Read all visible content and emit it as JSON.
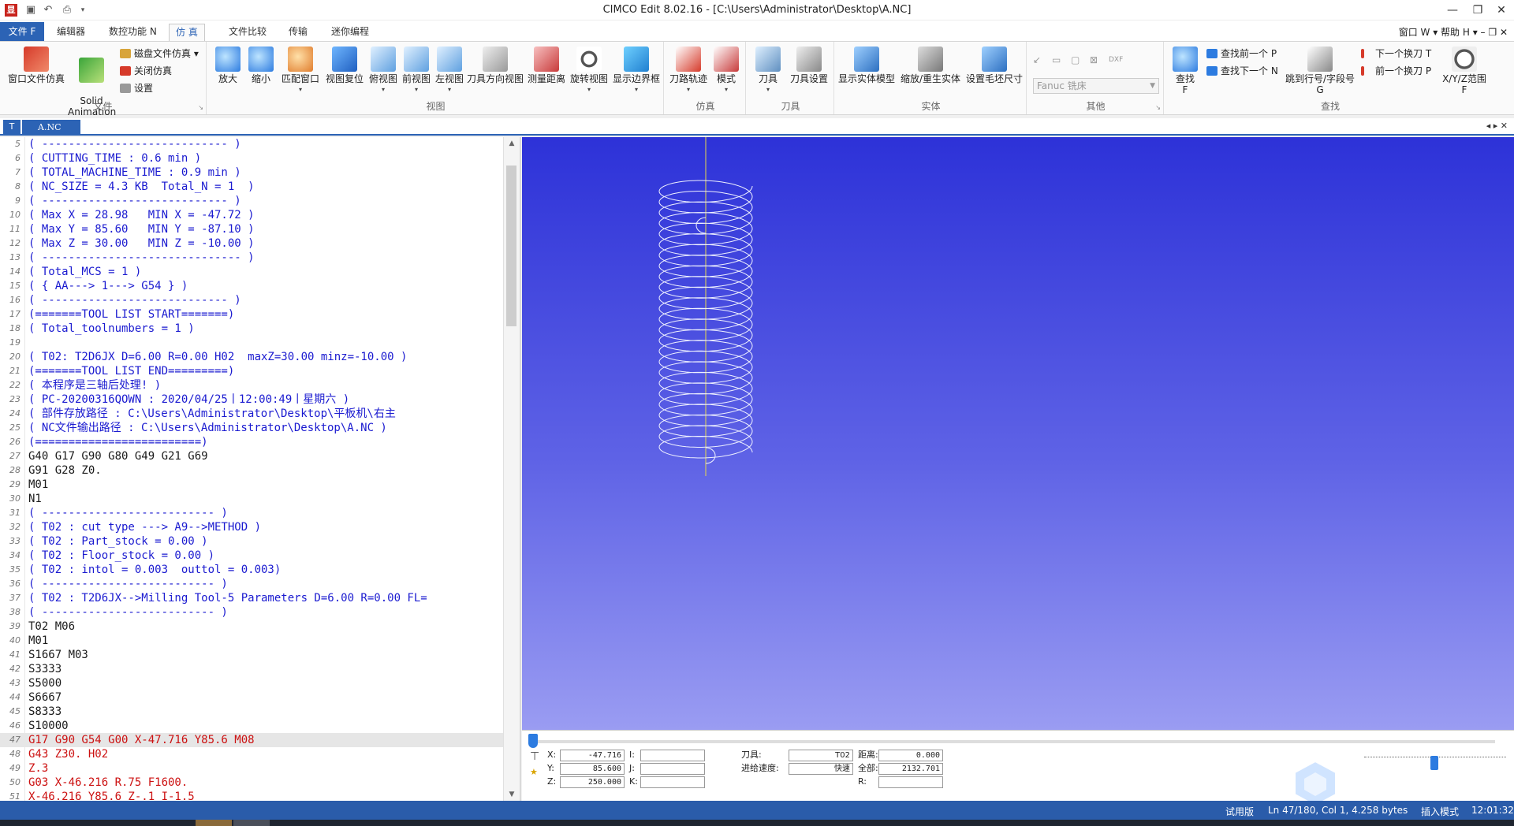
{
  "titlebar": {
    "title": "CIMCO Edit 8.02.16 - [C:\\Users\\Administrator\\Desktop\\A.NC]",
    "app_icon": "显",
    "qat_icons": [
      "save-icon",
      "undo-icon",
      "print-icon",
      "more-icon"
    ]
  },
  "ribbon_tabs": {
    "file": "文件 F",
    "tabs": [
      "编辑器",
      "数控功能 N",
      "仿 真",
      "文件比较",
      "传输",
      "迷你编程"
    ],
    "active_index": 2,
    "window_menu": "窗口 W",
    "help_menu": "帮助 H"
  },
  "ribbon": {
    "file_group": {
      "label": "文件",
      "window_sim": "窗口文件仿真",
      "solid_animation": "Solid\nAnimation",
      "disk_sim": "磁盘文件仿真",
      "close_sim": "关闭仿真",
      "settings": "设置"
    },
    "view_group": {
      "label": "视图",
      "buttons": [
        "放大",
        "缩小",
        "匹配窗口",
        "视图复位",
        "俯视图",
        "前视图",
        "左视图",
        "刀具方向视图",
        "测量距离",
        "旋转视图",
        "显示边界框"
      ]
    },
    "sim_group": {
      "label": "仿真",
      "buttons": [
        "刀路轨迹",
        "模式"
      ]
    },
    "tool_group": {
      "label": "刀具",
      "buttons": [
        "刀具",
        "刀具设置"
      ]
    },
    "solid_group": {
      "label": "实体",
      "buttons": [
        "显示实体模型",
        "缩放/重生实体",
        "设置毛坯尺寸"
      ]
    },
    "other_group": {
      "label": "其他",
      "machine_select": "Fanuc 铣床"
    },
    "find_group": {
      "label": "查找",
      "find": "查找\nF",
      "find_prev": "查找前一个 P",
      "find_next": "查找下一个 N",
      "jump_line": "跳到行号/字段号\nG",
      "next_tool": "下一个换刀 T",
      "prev_tool": "前一个换刀 P",
      "xyz_range": "X/Y/Z范围\nF"
    }
  },
  "doc_tab": {
    "name": "A.NC"
  },
  "editor": {
    "lines": [
      {
        "n": "5",
        "t": "( ---------------------------- )",
        "c": "cmt"
      },
      {
        "n": "6",
        "t": "( CUTTING_TIME : 0.6 min )",
        "c": "cmt"
      },
      {
        "n": "7",
        "t": "( TOTAL_MACHINE_TIME : 0.9 min )",
        "c": "cmt"
      },
      {
        "n": "8",
        "t": "( NC_SIZE = 4.3 KB  Total_N = 1  )",
        "c": "cmt"
      },
      {
        "n": "9",
        "t": "( ---------------------------- )",
        "c": "cmt"
      },
      {
        "n": "10",
        "t": "( Max X = 28.98   MIN X = -47.72 )",
        "c": "cmt"
      },
      {
        "n": "11",
        "t": "( Max Y = 85.60   MIN Y = -87.10 )",
        "c": "cmt"
      },
      {
        "n": "12",
        "t": "( Max Z = 30.00   MIN Z = -10.00 )",
        "c": "cmt"
      },
      {
        "n": "13",
        "t": "( ------------------------------ )",
        "c": "cmt"
      },
      {
        "n": "14",
        "t": "( Total_MCS = 1 )",
        "c": "cmt"
      },
      {
        "n": "15",
        "t": "( { AA---> 1---> G54 } )",
        "c": "cmt"
      },
      {
        "n": "16",
        "t": "( ---------------------------- )",
        "c": "cmt"
      },
      {
        "n": "17",
        "t": "(=======TOOL LIST START=======)",
        "c": "cmt"
      },
      {
        "n": "18",
        "t": "( Total_toolnumbers = 1 )",
        "c": "cmt"
      },
      {
        "n": "19",
        "t": "",
        "c": "cmt"
      },
      {
        "n": "20",
        "t": "( T02: T2D6JX D=6.00 R=0.00 H02  maxZ=30.00 minz=-10.00 )",
        "c": "cmt"
      },
      {
        "n": "21",
        "t": "(=======TOOL LIST END=========)",
        "c": "cmt"
      },
      {
        "n": "22",
        "t": "( 本程序是三轴后处理! )",
        "c": "cmt"
      },
      {
        "n": "23",
        "t": "( PC-20200316QOWN : 2020/04/25丨12:00:49丨星期六 )",
        "c": "cmt"
      },
      {
        "n": "24",
        "t": "( 部件存放路径 : C:\\Users\\Administrator\\Desktop\\平板机\\右主",
        "c": "cmt"
      },
      {
        "n": "25",
        "t": "( NC文件输出路径 : C:\\Users\\Administrator\\Desktop\\A.NC )",
        "c": "cmt"
      },
      {
        "n": "26",
        "t": "(=========================)",
        "c": "cmt"
      },
      {
        "n": "27",
        "t": "G40 G17 G90 G80 G49 G21 G69",
        "c": "cod"
      },
      {
        "n": "28",
        "t": "G91 G28 Z0.",
        "c": "cod"
      },
      {
        "n": "29",
        "t": "M01",
        "c": "cod"
      },
      {
        "n": "30",
        "t": "N1",
        "c": "cod"
      },
      {
        "n": "31",
        "t": "( -------------------------- )",
        "c": "cmt"
      },
      {
        "n": "32",
        "t": "( T02 : cut type ---> A9-->METHOD )",
        "c": "cmt"
      },
      {
        "n": "33",
        "t": "( T02 : Part_stock = 0.00 )",
        "c": "cmt"
      },
      {
        "n": "34",
        "t": "( T02 : Floor_stock = 0.00 )",
        "c": "cmt"
      },
      {
        "n": "35",
        "t": "( T02 : intol = 0.003  outtol = 0.003)",
        "c": "cmt"
      },
      {
        "n": "36",
        "t": "( -------------------------- )",
        "c": "cmt"
      },
      {
        "n": "37",
        "t": "( T02 : T2D6JX-->Milling Tool-5 Parameters D=6.00 R=0.00 FL=",
        "c": "cmt"
      },
      {
        "n": "38",
        "t": "( -------------------------- )",
        "c": "cmt"
      },
      {
        "n": "39",
        "t": "T02 M06",
        "c": "cod"
      },
      {
        "n": "40",
        "t": "M01",
        "c": "cod"
      },
      {
        "n": "41",
        "t": "S1667 M03",
        "c": "cod"
      },
      {
        "n": "42",
        "t": "S3333",
        "c": "cod"
      },
      {
        "n": "43",
        "t": "S5000",
        "c": "cod"
      },
      {
        "n": "44",
        "t": "S6667",
        "c": "cod"
      },
      {
        "n": "45",
        "t": "S8333",
        "c": "cod"
      },
      {
        "n": "46",
        "t": "S10000",
        "c": "cod"
      },
      {
        "n": "47",
        "t": "G17 G90 G54 G00 X-47.716 Y85.6 M08",
        "c": "red",
        "hl": true
      },
      {
        "n": "48",
        "t": "G43 Z30. H02",
        "c": "red"
      },
      {
        "n": "49",
        "t": "Z.3",
        "c": "red"
      },
      {
        "n": "50",
        "t": "G03 X-46.216 R.75 F1600.",
        "c": "red"
      },
      {
        "n": "51",
        "t": "X-46.216 Y85.6 Z-.1 I-1.5",
        "c": "red"
      }
    ]
  },
  "sim_readout": {
    "x_label": "X:",
    "x_value": "-47.716",
    "y_label": "Y:",
    "y_value": "85.600",
    "z_label": "Z:",
    "z_value": "250.000",
    "i_label": "I:",
    "j_label": "J:",
    "k_label": "K:",
    "tool_label": "刀具:",
    "tool_value": "T02",
    "feed_label": "进给速度:",
    "feed_value": "快速",
    "dist_label": "距离:",
    "dist_value": "0.000",
    "total_label": "全部:",
    "total_value": "2132.701",
    "r_label": "R:"
  },
  "statusbar": {
    "trial": "试用版",
    "position": "Ln 47/180, Col 1, 4.258 bytes",
    "mode": "插入模式",
    "time": "12:01:32"
  },
  "colors": {
    "accent": "#2c63b5",
    "comment": "#1a1ad0",
    "active_code": "#cc1111",
    "statusbar": "#2a5caa"
  }
}
